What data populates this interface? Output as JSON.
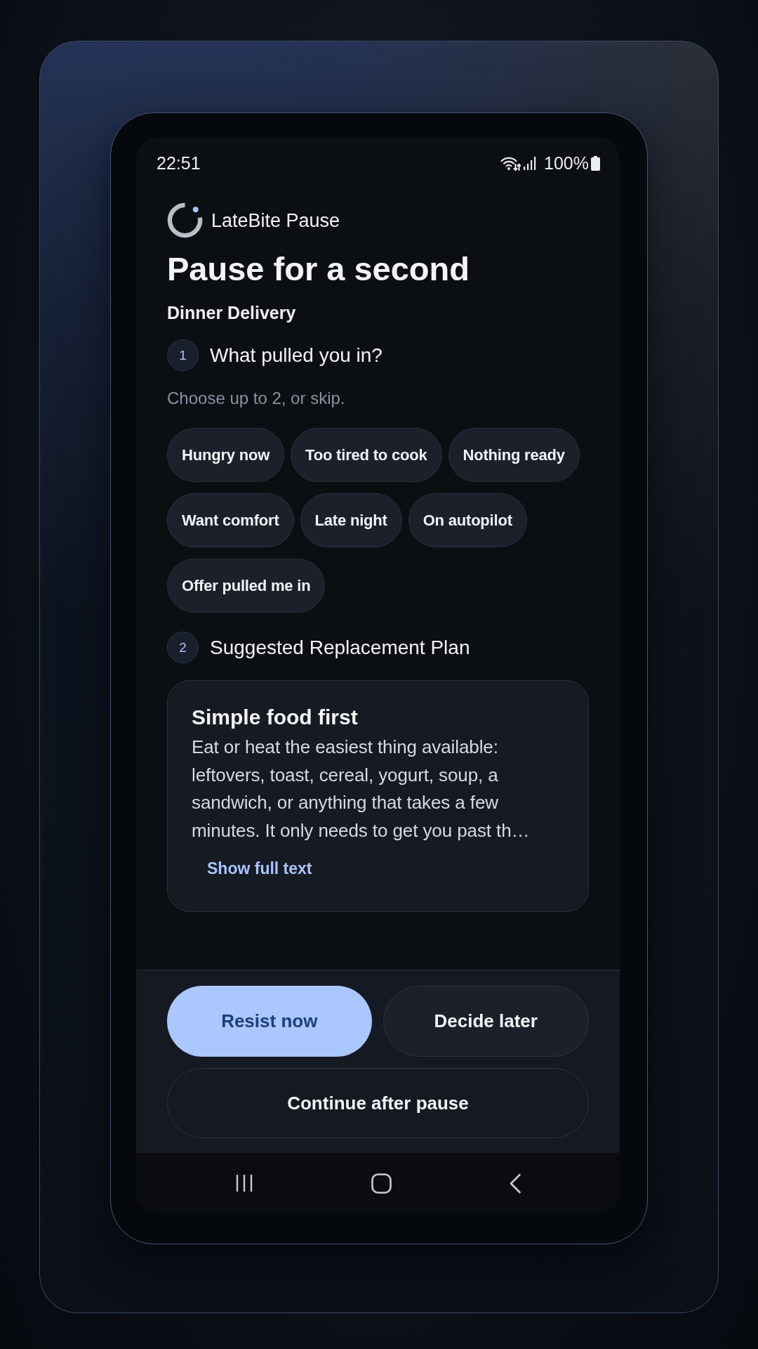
{
  "status_bar": {
    "time": "22:51",
    "battery": "100%"
  },
  "app": {
    "name": "LateBite Pause"
  },
  "title": "Pause for a second",
  "subtitle": "Dinner Delivery",
  "steps": [
    {
      "kind": "choices",
      "number": "1",
      "title": "What pulled you in?",
      "hint": "Choose up to 2, or skip.",
      "chips": [
        {
          "label": "Hungry now",
          "selected": false
        },
        {
          "label": "Too tired to cook",
          "selected": false
        },
        {
          "label": "Nothing ready",
          "selected": false
        },
        {
          "label": "Want comfort",
          "selected": false
        },
        {
          "label": "Late night",
          "selected": false
        },
        {
          "label": "On autopilot",
          "selected": false
        },
        {
          "label": "Offer pulled me in",
          "selected": false
        }
      ]
    },
    {
      "kind": "plan",
      "number": "2",
      "title": "Suggested Replacement Plan",
      "card": {
        "title": "Simple food first",
        "body": "Eat or heat the easiest thing available: leftovers, toast, cereal, yogurt, soup, a sandwich, or anything that takes a few minutes. It only needs to get you past th…",
        "link": "Show full text"
      }
    }
  ],
  "action_rows": [
    {
      "buttons": [
        {
          "label": "Resist now",
          "kind": "filled"
        },
        {
          "label": "Decide later",
          "kind": "tonal"
        }
      ]
    },
    {
      "buttons": [
        {
          "label": "Continue after pause",
          "kind": "outlined"
        }
      ]
    }
  ]
}
